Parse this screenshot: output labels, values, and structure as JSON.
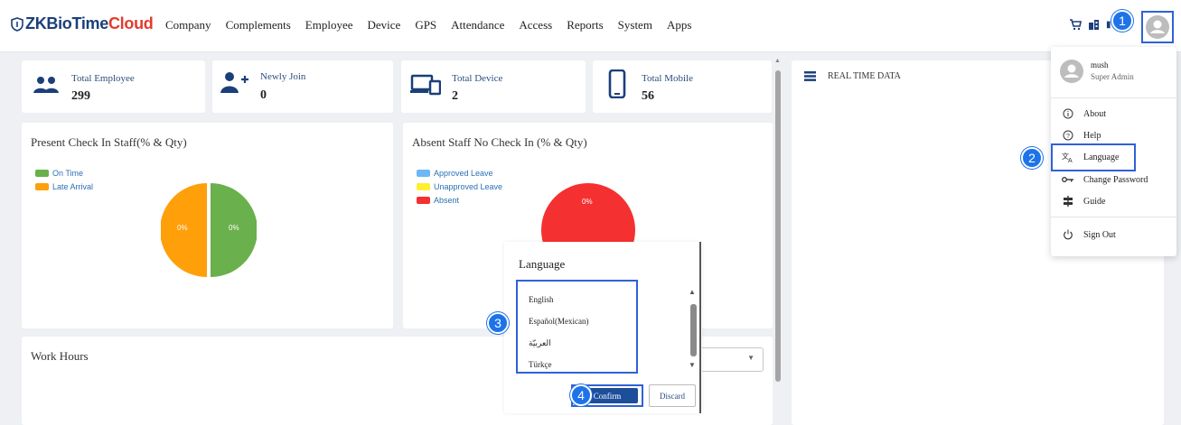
{
  "brand": {
    "part1": "ZKBioTime",
    "part2": "Cloud",
    "brand_color": "#1b3f7a",
    "accent_color": "#e23b2e"
  },
  "nav": [
    "Company",
    "Complements",
    "Employee",
    "Device",
    "GPS",
    "Attendance",
    "Access",
    "Reports",
    "System",
    "Apps"
  ],
  "header_icons": [
    "cart-icon",
    "building-icon",
    "avatar-icon"
  ],
  "steps": [
    "1",
    "2",
    "3",
    "4"
  ],
  "stats": [
    {
      "label": "Total Employee",
      "value": "299",
      "icon": "people-icon"
    },
    {
      "label": "Newly Join",
      "value": "0",
      "icon": "user-plus-icon"
    },
    {
      "label": "Total Device",
      "value": "2",
      "icon": "devices-icon"
    },
    {
      "label": "Total Mobile",
      "value": "56",
      "icon": "mobile-icon"
    }
  ],
  "present_chart": {
    "title": "Present Check In Staff(% & Qty)",
    "legend": [
      {
        "name": "On Time",
        "color": "#6ab04c"
      },
      {
        "name": "Late Arrival",
        "color": "#ff9f0a"
      }
    ],
    "slice_labels": [
      "0%",
      "0%"
    ]
  },
  "absent_chart": {
    "title": "Absent Staff No Check In (% & Qty)",
    "legend": [
      {
        "name": "Approved Leave",
        "color": "#6db8f5"
      },
      {
        "name": "Unapproved Leave",
        "color": "#ffee33"
      },
      {
        "name": "Absent",
        "color": "#f53030"
      }
    ],
    "slice_label": "0%"
  },
  "work_hours": {
    "title": "Work Hours"
  },
  "realtime": {
    "title": "REAL TIME DATA",
    "icon": "list-icon"
  },
  "user_menu": {
    "name": "mush",
    "role": "Super Admin",
    "items": [
      {
        "label": "About",
        "icon": "info-icon"
      },
      {
        "label": "Help",
        "icon": "help-icon"
      },
      {
        "label": "Language",
        "icon": "translate-icon"
      },
      {
        "label": "Change Password",
        "icon": "key-icon"
      },
      {
        "label": "Guide",
        "icon": "signpost-icon"
      },
      {
        "label": "Sign Out",
        "icon": "power-icon"
      }
    ]
  },
  "language_dialog": {
    "title": "Language",
    "options": [
      "English",
      "Español(Mexican)",
      "العربيّة",
      "Türkçe"
    ],
    "confirm": "Confirm",
    "discard": "Discard"
  }
}
